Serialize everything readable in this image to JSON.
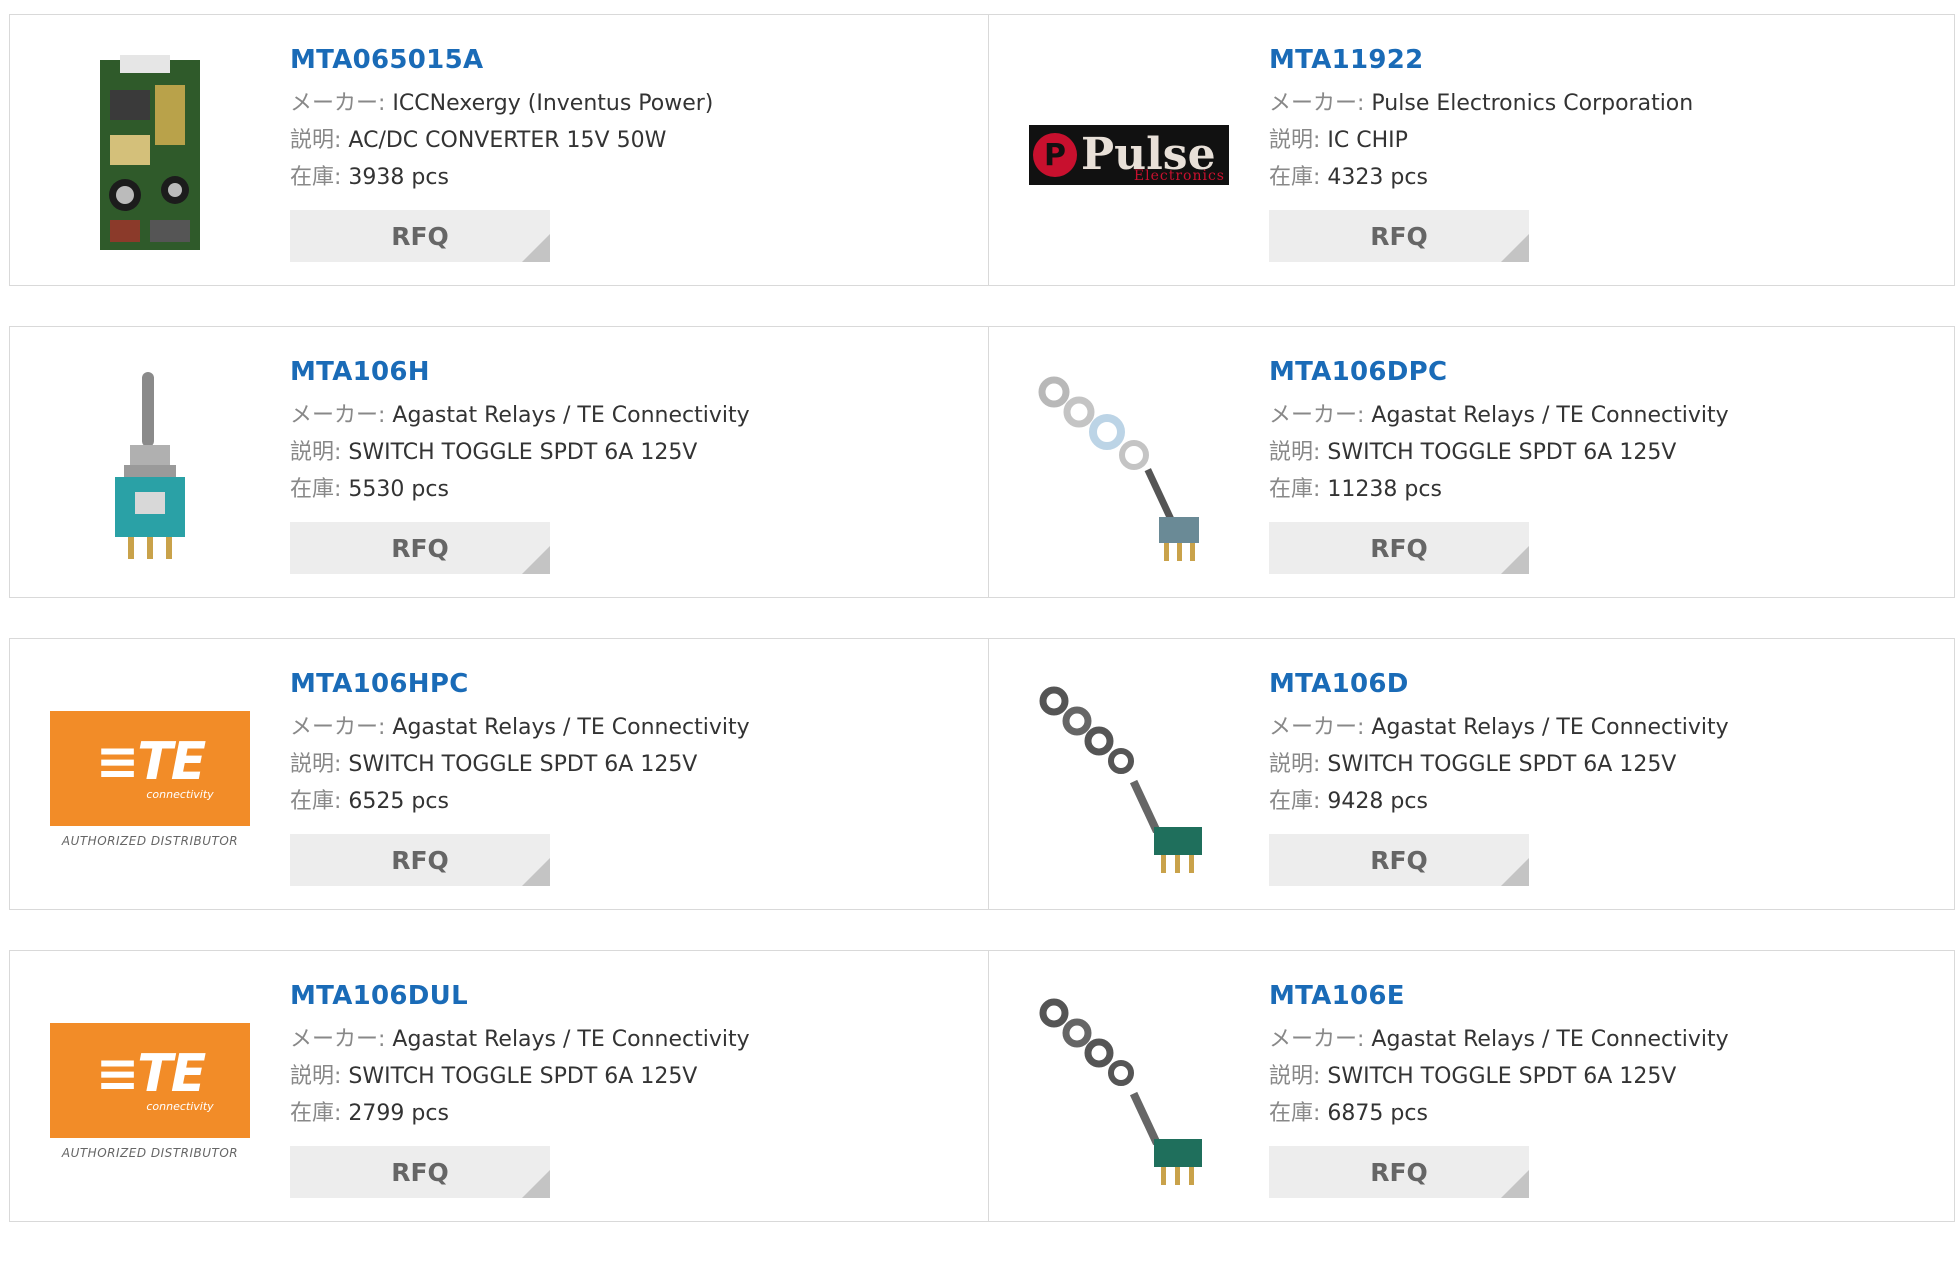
{
  "labels": {
    "maker": "メーカー:",
    "desc": "説明:",
    "stock": "在庫:",
    "rfq": "RFQ"
  },
  "logos": {
    "te_mark": "≡TE",
    "te_sub": "connectivity",
    "te_authorized": "AUTHORIZED DISTRIBUTOR",
    "pulse_mark": "Pulse",
    "pulse_sub": "Electronics"
  },
  "products": [
    {
      "part": "MTA065015A",
      "maker": "ICCNexergy (Inventus Power)",
      "desc": "AC/DC CONVERTER 15V 50W",
      "stock": "3938 pcs",
      "image": "power-board"
    },
    {
      "part": "MTA11922",
      "maker": "Pulse Electronics Corporation",
      "desc": "IC CHIP",
      "stock": "4323 pcs",
      "image": "pulse-logo"
    },
    {
      "part": "MTA106H",
      "maker": "Agastat Relays / TE Connectivity",
      "desc": "SWITCH TOGGLE SPDT 6A 125V",
      "stock": "5530 pcs",
      "image": "toggle-switch"
    },
    {
      "part": "MTA106DPC",
      "maker": "Agastat Relays / TE Connectivity",
      "desc": "SWITCH TOGGLE SPDT 6A 125V",
      "stock": "11238 pcs",
      "image": "toggle-switch-kit"
    },
    {
      "part": "MTA106HPC",
      "maker": "Agastat Relays / TE Connectivity",
      "desc": "SWITCH TOGGLE SPDT 6A 125V",
      "stock": "6525 pcs",
      "image": "te-logo"
    },
    {
      "part": "MTA106D",
      "maker": "Agastat Relays / TE Connectivity",
      "desc": "SWITCH TOGGLE SPDT 6A 125V",
      "stock": "9428 pcs",
      "image": "toggle-switch-kit-green"
    },
    {
      "part": "MTA106DUL",
      "maker": "Agastat Relays / TE Connectivity",
      "desc": "SWITCH TOGGLE SPDT 6A 125V",
      "stock": "2799 pcs",
      "image": "te-logo"
    },
    {
      "part": "MTA106E",
      "maker": "Agastat Relays / TE Connectivity",
      "desc": "SWITCH TOGGLE SPDT 6A 125V",
      "stock": "6875 pcs",
      "image": "toggle-switch-kit-green"
    }
  ]
}
